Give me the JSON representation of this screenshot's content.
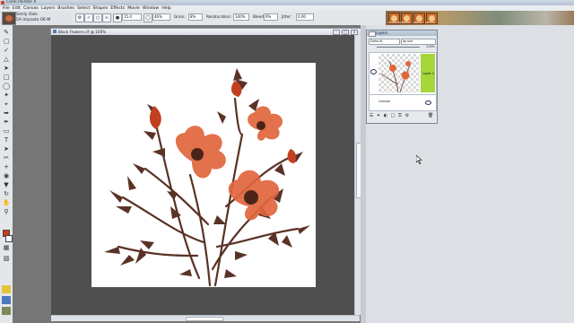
{
  "window": {
    "title": "Corel Painter X"
  },
  "menu": [
    "File",
    "Edit",
    "Canvas",
    "Layers",
    "Brushes",
    "Select",
    "Shapes",
    "Effects",
    "Movie",
    "Window",
    "Help"
  ],
  "brush": {
    "category": "Smily Oals",
    "variant": "5A Impasto 06-M"
  },
  "properties": [
    {
      "label": "",
      "value": "15.4"
    },
    {
      "label": "",
      "value": "46%"
    },
    {
      "label": "Grain:",
      "value": "8%"
    },
    {
      "label": "Resaturation:",
      "value": "100%"
    },
    {
      "label": "Bleed:",
      "value": "6%"
    },
    {
      "label": "Jitter:",
      "value": "0.00"
    }
  ],
  "media": [
    "Gradient",
    "Pattern",
    "Weave",
    "Nozzle"
  ],
  "document": {
    "title": "Black Flowers.rif @ 100%"
  },
  "layers": {
    "title": "Layers",
    "composite_method": "Default",
    "composite_depth": "Ignore",
    "opacity": "100%",
    "layer_name": "Layer 1",
    "canvas_name": "Canvas"
  },
  "colors": {
    "canvas": "#ffffff",
    "workspace": "#4f4f4f",
    "petal": "#e0663d",
    "stem": "#5a3226",
    "layer_selected": "#a6d63a"
  }
}
